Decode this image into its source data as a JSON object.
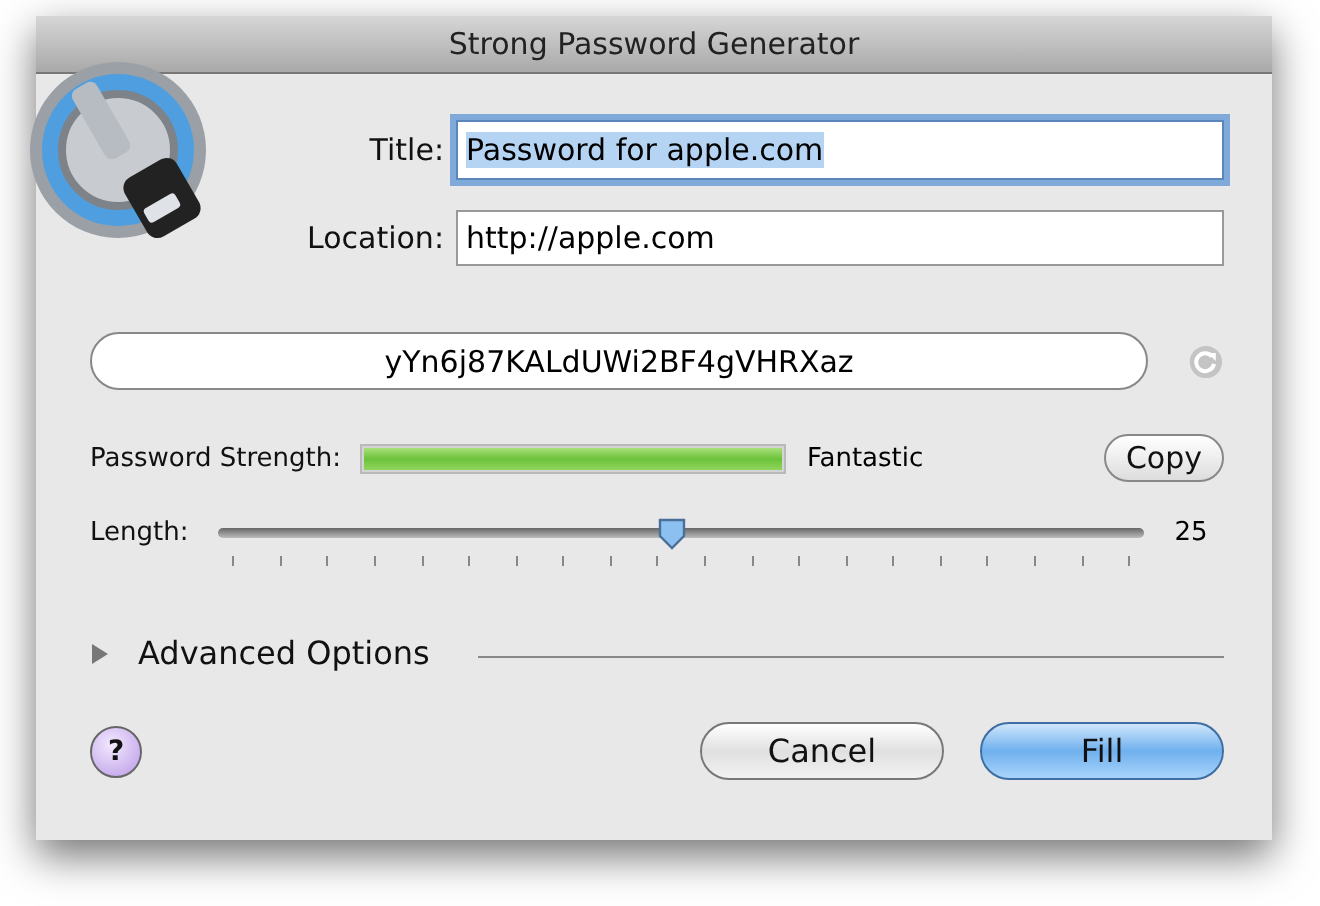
{
  "window": {
    "title": "Strong Password Generator"
  },
  "fields": [
    {
      "label": "Title:",
      "value": "Password for apple.com",
      "focused": true
    },
    {
      "label": "Location:",
      "value": "http://apple.com",
      "focused": false
    }
  ],
  "password": {
    "value": "yYn6j87KALdUWi2BF4gVHRXaz"
  },
  "strength": {
    "label": "Password Strength:",
    "level": 1,
    "rating": "Fantastic"
  },
  "copy_button": "Copy",
  "length": {
    "label": "Length:",
    "level": 0.49,
    "reading": "25"
  },
  "advanced": {
    "label": "Advanced Options",
    "expanded": false
  },
  "help_button": "?",
  "buttons": [
    {
      "label": "Cancel",
      "kind": "normal"
    },
    {
      "label": "Fill",
      "kind": "default"
    }
  ]
}
